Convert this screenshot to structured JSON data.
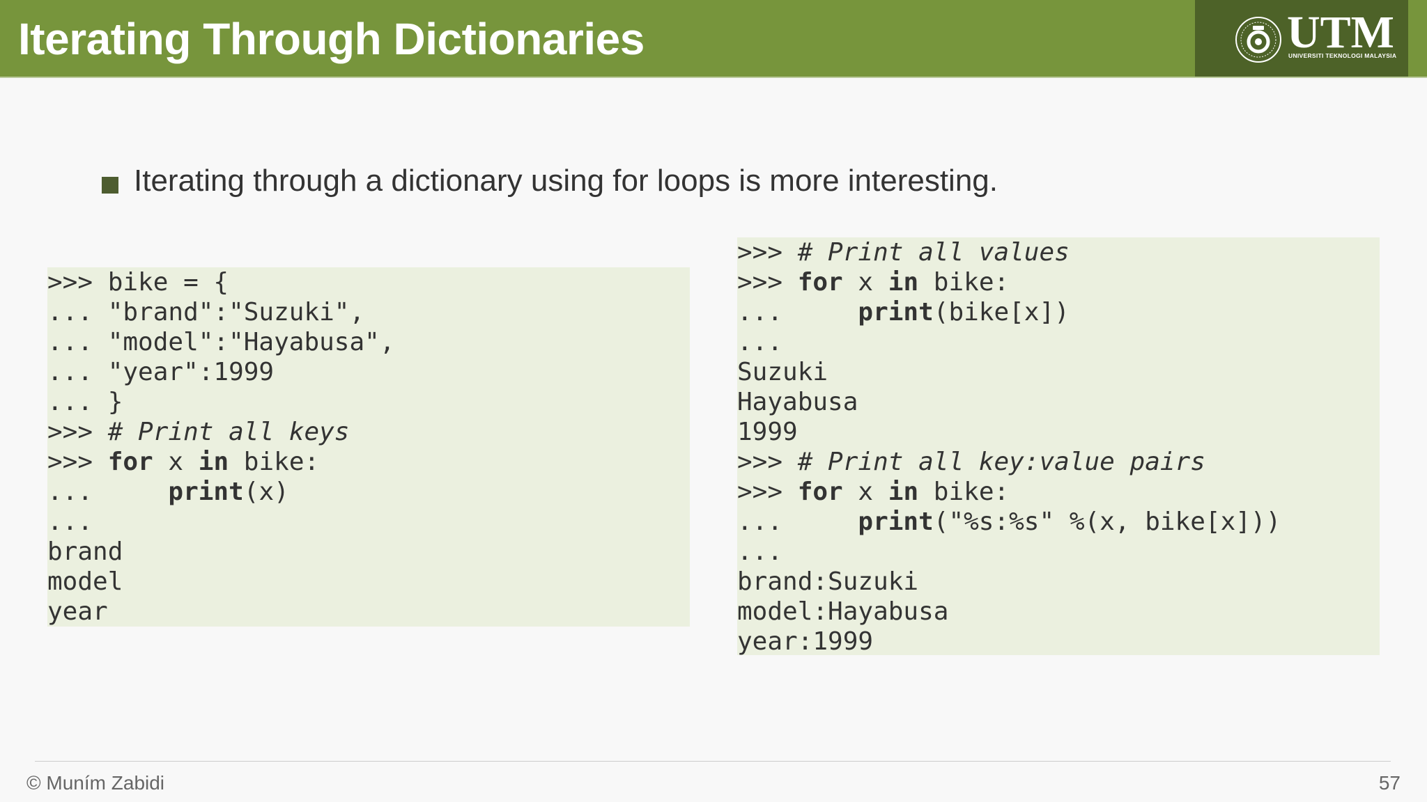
{
  "slide": {
    "title": "Iterating Through Dictionaries",
    "logo": {
      "text": "UTM",
      "subtitle": "UNIVERSITI TEKNOLOGI MALAYSIA",
      "seal_icon": "utm-seal-icon"
    },
    "bullet": "Iterating through a dictionary using for loops is more interesting.",
    "footer": {
      "author": "© Muním Zabidi",
      "page_number": "57"
    }
  },
  "code_left": [
    [
      {
        "t": ">>> bike = {"
      }
    ],
    [
      {
        "t": "... \"brand\":\"Suzuki\","
      }
    ],
    [
      {
        "t": "... \"model\":\"Hayabusa\","
      }
    ],
    [
      {
        "t": "... \"year\":1999"
      }
    ],
    [
      {
        "t": "... }"
      }
    ],
    [
      {
        "t": ">>> "
      },
      {
        "t": "# Print all keys",
        "c": "cm"
      }
    ],
    [
      {
        "t": ">>> "
      },
      {
        "t": "for",
        "c": "kw"
      },
      {
        "t": " x "
      },
      {
        "t": "in",
        "c": "kw"
      },
      {
        "t": " bike:"
      }
    ],
    [
      {
        "t": "...     "
      },
      {
        "t": "print",
        "c": "kw"
      },
      {
        "t": "(x)"
      }
    ],
    [
      {
        "t": "..."
      }
    ],
    [
      {
        "t": "brand"
      }
    ],
    [
      {
        "t": "model"
      }
    ],
    [
      {
        "t": "year"
      }
    ]
  ],
  "code_right": [
    [
      {
        "t": ">>> "
      },
      {
        "t": "# Print all values",
        "c": "cm"
      }
    ],
    [
      {
        "t": ">>> "
      },
      {
        "t": "for",
        "c": "kw"
      },
      {
        "t": " x "
      },
      {
        "t": "in",
        "c": "kw"
      },
      {
        "t": " bike:"
      }
    ],
    [
      {
        "t": "...     "
      },
      {
        "t": "print",
        "c": "kw"
      },
      {
        "t": "(bike[x])"
      }
    ],
    [
      {
        "t": "..."
      }
    ],
    [
      {
        "t": "Suzuki"
      }
    ],
    [
      {
        "t": "Hayabusa"
      }
    ],
    [
      {
        "t": "1999"
      }
    ],
    [
      {
        "t": ">>> "
      },
      {
        "t": "# Print all key:value pairs",
        "c": "cm"
      }
    ],
    [
      {
        "t": ">>> "
      },
      {
        "t": "for",
        "c": "kw"
      },
      {
        "t": " x "
      },
      {
        "t": "in",
        "c": "kw"
      },
      {
        "t": " bike:"
      }
    ],
    [
      {
        "t": "...     "
      },
      {
        "t": "print",
        "c": "kw"
      },
      {
        "t": "(\"%s:%s\" %(x, bike[x]))"
      }
    ],
    [
      {
        "t": "..."
      }
    ],
    [
      {
        "t": "brand:Suzuki"
      }
    ],
    [
      {
        "t": "model:Hayabusa"
      }
    ],
    [
      {
        "t": "year:1999"
      }
    ]
  ],
  "colors": {
    "header_green": "#77953c",
    "logo_box": "#4d6228",
    "bullet_square": "#4e5d30",
    "code_background": "#ebf0df",
    "text": "#333333"
  }
}
